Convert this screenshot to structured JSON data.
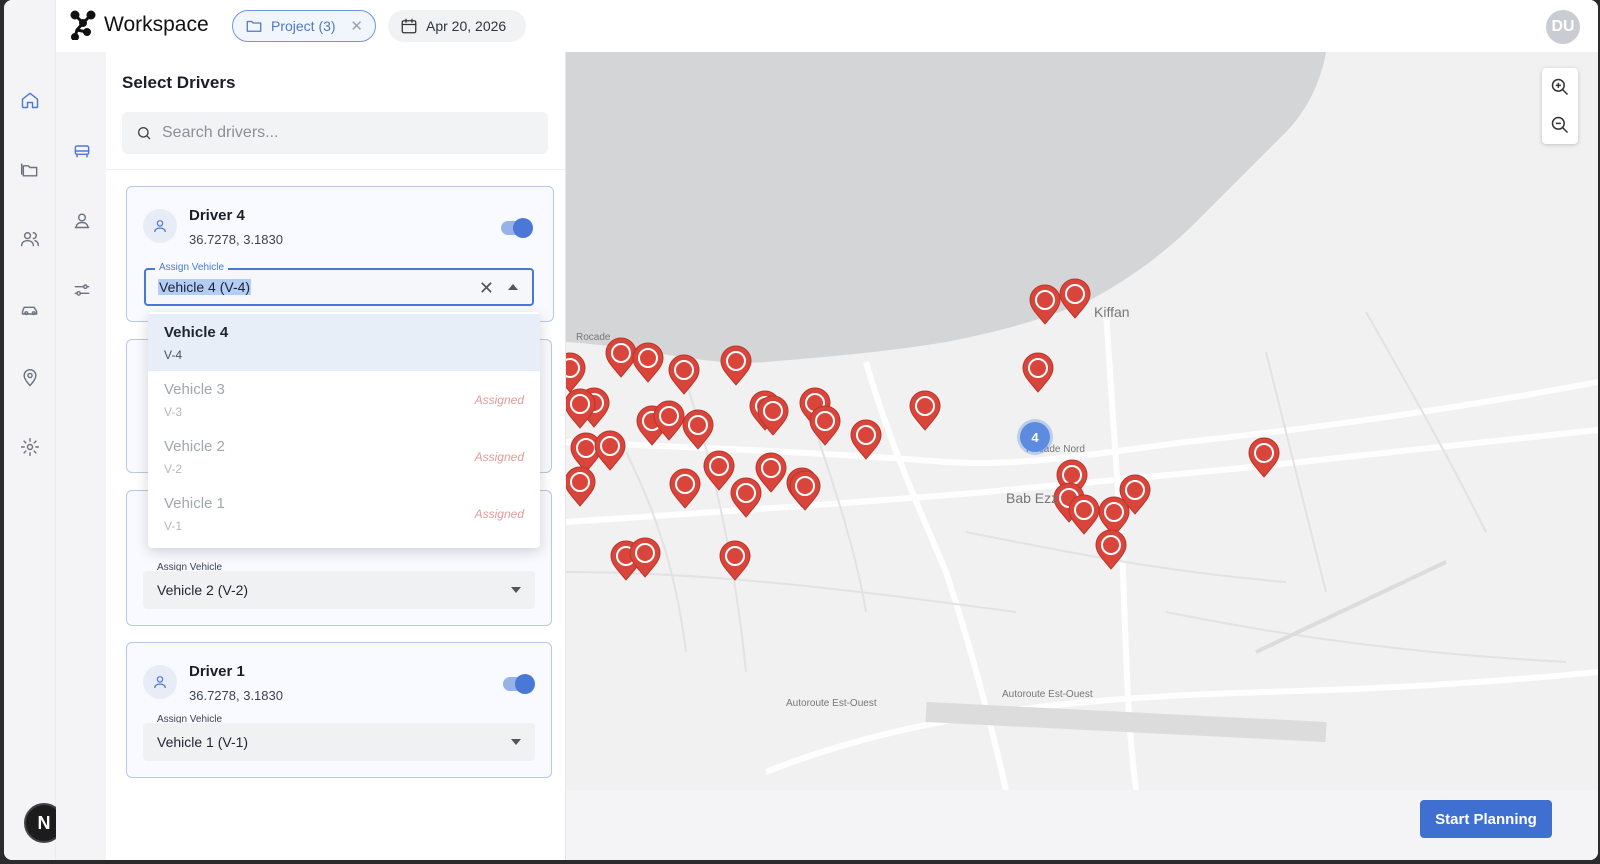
{
  "header": {
    "app_title": "Workspace",
    "project_chip": "Project (3)",
    "date_chip": "Apr 20, 2026",
    "user_initials": "DU"
  },
  "rail": {
    "items": [
      "home-icon",
      "folders-icon",
      "users-icon",
      "car-icon",
      "location-pin-icon",
      "settings-icon"
    ],
    "active": "home-icon",
    "bottom_badge": "N"
  },
  "subrail": {
    "items": [
      "vehicle-icon",
      "driver-pin-icon",
      "sliders-icon"
    ],
    "active": "vehicle-icon"
  },
  "panel": {
    "title": "Select Drivers",
    "search_placeholder": "Search drivers...",
    "drivers": [
      {
        "name": "Driver 4",
        "coords": "36.7278, 3.1830",
        "enabled": true,
        "field_label": "Assign Vehicle",
        "vehicle": "Vehicle 4 (V-4)"
      },
      {
        "name": "",
        "coords": "",
        "enabled": true,
        "field_label": "Assign Vehicle",
        "vehicle": "Vehicle 2 (V-2)"
      },
      {
        "name": "Driver 1",
        "coords": "36.7278, 3.1830",
        "enabled": true,
        "field_label": "Assign Vehicle",
        "vehicle": "Vehicle 1 (V-1)"
      }
    ]
  },
  "dropdown": {
    "options": [
      {
        "label": "Vehicle 4",
        "code": "V-4",
        "tag": "",
        "selected": true
      },
      {
        "label": "Vehicle 3",
        "code": "V-3",
        "tag": "Assigned",
        "selected": false
      },
      {
        "label": "Vehicle 2",
        "code": "V-2",
        "tag": "Assigned",
        "selected": false
      },
      {
        "label": "Vehicle 1",
        "code": "V-1",
        "tag": "Assigned",
        "selected": false
      }
    ]
  },
  "map": {
    "labels": {
      "kiffan": "Kiffan",
      "bab": "Bab Ezz",
      "rocade_nord": "Rocade Nord",
      "autoroute_1": "Autoroute Est-Ouest",
      "autoroute_2": "Autoroute Est-Ouest",
      "rocade": "Rocade"
    },
    "cluster_count": "4",
    "pin_color": "#d9453a",
    "water_color": "#d4d5d7"
  },
  "footer": {
    "start_button": "Start Planning"
  },
  "colors": {
    "accent": "#4a78d6",
    "button": "#3f6fd1"
  }
}
